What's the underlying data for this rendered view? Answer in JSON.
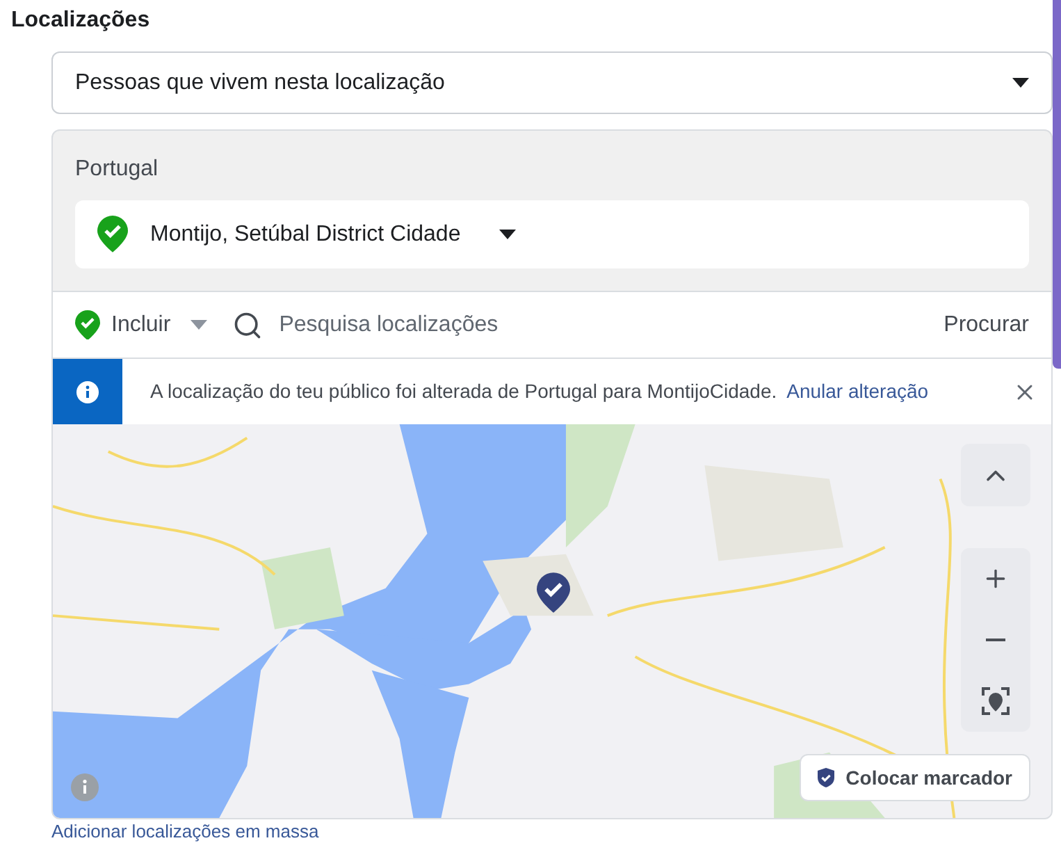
{
  "section_title": "Localizações",
  "audience_select": {
    "value": "Pessoas que vivem nesta localização"
  },
  "panel": {
    "country": "Portugal",
    "locations": [
      {
        "name": "Montijo, Setúbal District Cidade",
        "kind": "included"
      }
    ],
    "include_select": {
      "value": "Incluir"
    },
    "search": {
      "placeholder": "Pesquisa localizações",
      "button": "Procurar"
    },
    "banner": {
      "message": "A localização do teu público foi alterada de Portugal para MontijoCidade.",
      "link": "Anular alteração"
    },
    "map": {
      "kind": "picture",
      "place_marker_button": "Colocar marcador"
    }
  },
  "bottom_link": "Adicionar localizações em massa"
}
